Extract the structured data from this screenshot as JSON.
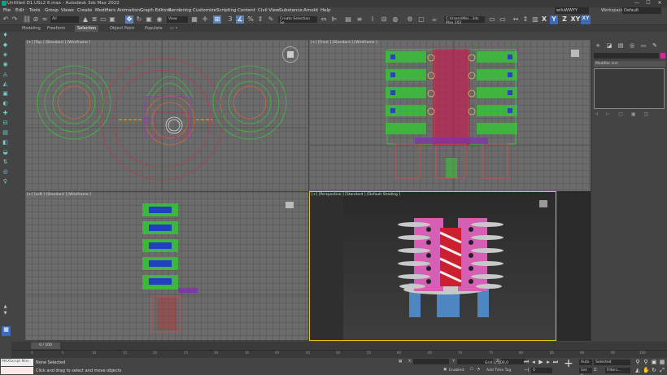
{
  "window": {
    "title": "Untitled D1.USL2 6.max - Autodesk 3ds Max 2022",
    "min": "—",
    "max": "☐",
    "close": "✕"
  },
  "menu": [
    "File",
    "Edit",
    "Tools",
    "Group",
    "Views",
    "Create",
    "Modifiers",
    "Animation",
    "Graph Editors",
    "Rendering",
    "Customize",
    "Scripting",
    "Content",
    "Civil View",
    "Substance",
    "Arnold",
    "Help"
  ],
  "user": "wiluWWYY",
  "workspace": {
    "label": "Workspaces:",
    "value": "Default"
  },
  "toolbar": {
    "filter": "All",
    "ref_coord": "View",
    "selection_set": "Create Selection Se",
    "path": "C:\\Users\\Mei...3ds Max 202",
    "axes": [
      "X",
      "Y",
      "Z",
      "XY",
      "XY"
    ]
  },
  "ribbon_tabs": [
    "Modeling",
    "Freeform",
    "Selection",
    "Object Paint",
    "Populate"
  ],
  "viewports": {
    "top": "[+] [Top ] [Standard ] [Wireframe ]",
    "front": "[+] [Front ] [Standard ] [Wireframe ]",
    "left": "[+] [Left ] [Standard ] [Wireframe ]",
    "perspective": "[+] [Perspective ] [Standard ] [Default Shading ]"
  },
  "command_panel": {
    "modifier_list": "Modifier List"
  },
  "timeline": {
    "frame": "0 / 100",
    "ticks": [
      "0",
      "5",
      "10",
      "15",
      "20",
      "25",
      "30",
      "35",
      "40",
      "45",
      "50",
      "55",
      "60",
      "65",
      "70",
      "75",
      "80",
      "85",
      "90",
      "95",
      "100"
    ]
  },
  "status": {
    "maxscript": "MAXScript Mini",
    "selection": "None Selected",
    "prompt": "Click and drag to select and move objects",
    "x": "X:",
    "y": "Y:",
    "z": "Z:",
    "grid": "Grid = 100,0",
    "enabled": "Enabled:",
    "add_time_tag": "Add Time Tag",
    "auto": "Auto",
    "set_k": "Set K.",
    "selected": "Selected",
    "filters": "Filters...",
    "frame": "0"
  }
}
